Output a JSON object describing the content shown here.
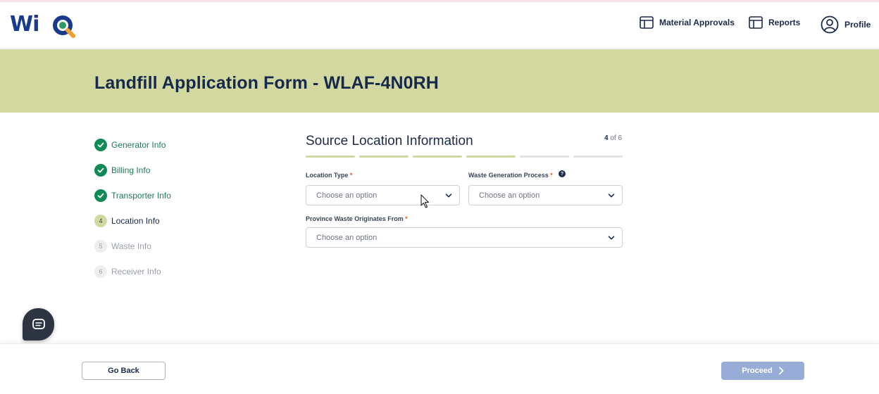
{
  "brand": {
    "logo_text": "Wi",
    "logo_icon": "magnifier-q-logo-icon"
  },
  "header": {
    "nav": [
      {
        "label": "Material Approvals",
        "icon": "layout-panel-icon"
      },
      {
        "label": "Reports",
        "icon": "layout-panel-icon"
      },
      {
        "label": "Profile",
        "icon": "user-circle-icon"
      }
    ]
  },
  "banner": {
    "title": "Landfill Application Form - WLAF-4N0RH"
  },
  "steps": [
    {
      "label": "Generator Info",
      "state": "done",
      "number": "1"
    },
    {
      "label": "Billing Info",
      "state": "done",
      "number": "2"
    },
    {
      "label": "Transporter Info",
      "state": "done",
      "number": "3"
    },
    {
      "label": "Location Info",
      "state": "active",
      "number": "4"
    },
    {
      "label": "Waste Info",
      "state": "pending",
      "number": "5"
    },
    {
      "label": "Receiver Info",
      "state": "pending",
      "number": "6"
    }
  ],
  "form": {
    "title": "Source Location Information",
    "step_current": "4",
    "step_of": "of 6",
    "progress": {
      "completed": 4,
      "total": 6
    },
    "fields": {
      "location_type": {
        "label": "Location Type",
        "required_mark": "*",
        "value": "Choose an option"
      },
      "waste_generation_process": {
        "label": "Waste Generation Process",
        "required_mark": "*",
        "value": "Choose an option",
        "help": "?"
      },
      "province_origin": {
        "label": "Province Waste Originates From",
        "required_mark": "*",
        "value": "Choose an option"
      }
    }
  },
  "footer": {
    "back_label": "Go Back",
    "proceed_label": "Proceed"
  },
  "colors": {
    "banner": "#d3d8a1",
    "done": "#0f8a55",
    "primary_disabled": "#98acd8",
    "required": "#e05a1e",
    "navy": "#14294b"
  }
}
